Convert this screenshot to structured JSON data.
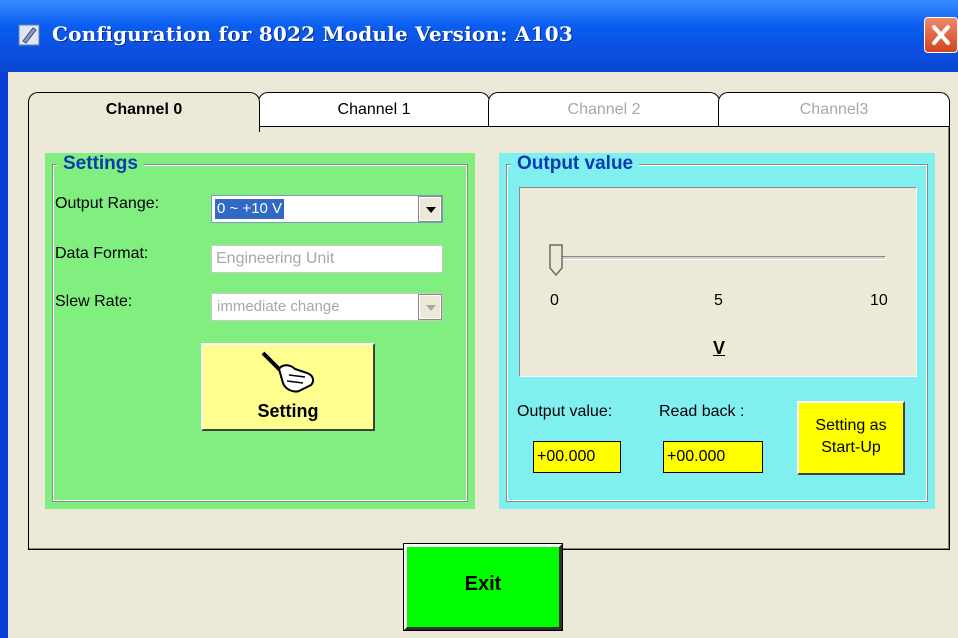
{
  "window": {
    "title": "Configuration for 8022 Module Version: A103"
  },
  "tabs": [
    {
      "label": "Channel 0",
      "state": "active"
    },
    {
      "label": "Channel 1",
      "state": "enabled"
    },
    {
      "label": "Channel 2",
      "state": "disabled"
    },
    {
      "label": "Channel3",
      "state": "disabled"
    }
  ],
  "settings": {
    "group_title": "Settings",
    "output_range_label": "Output Range:",
    "output_range_value": "0 ~ +10 V",
    "data_format_label": "Data Format:",
    "data_format_value": "Engineering Unit",
    "slew_rate_label": "Slew Rate:",
    "slew_rate_value": "immediate change",
    "setting_button": "Setting",
    "setting_button_icon": "hand-pointer-icon"
  },
  "output": {
    "group_title": "Output value",
    "slider": {
      "min_label": "0",
      "mid_label": "5",
      "max_label": "10",
      "value": 0
    },
    "unit": "V",
    "output_value_label": "Output value:",
    "output_value": "+00.000",
    "read_back_label": "Read back :",
    "read_back_value": "+00.000",
    "startup_button_line1": "Setting as",
    "startup_button_line2": "Start-Up"
  },
  "exit_button": "Exit",
  "colors": {
    "settings_bg": "#80ef80",
    "output_bg": "#80efef",
    "button_yellow": "#ffff90",
    "value_yellow": "#ffff00",
    "exit_green": "#00ff00",
    "group_title": "#0b3bb3"
  }
}
